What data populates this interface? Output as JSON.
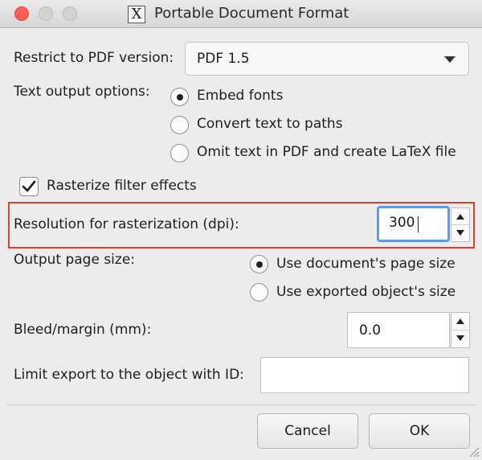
{
  "window": {
    "title": "Portable Document Format",
    "app_icon": "X"
  },
  "pdf_version": {
    "label": "Restrict to PDF version:",
    "value": "PDF 1.5"
  },
  "text_output": {
    "label": "Text output options:",
    "options": [
      "Embed fonts",
      "Convert text to paths",
      "Omit text in PDF and create LaTeX file"
    ],
    "selected": "Embed fonts"
  },
  "rasterize": {
    "label": "Rasterize filter effects",
    "checked": true
  },
  "resolution": {
    "label": "Resolution for rasterization (dpi):",
    "value": "300"
  },
  "page_size": {
    "label": "Output page size:",
    "options": [
      "Use document's page size",
      "Use exported object's size"
    ],
    "selected": "Use document's page size"
  },
  "bleed": {
    "label": "Bleed/margin (mm):",
    "value": "0.0"
  },
  "limit_export": {
    "label": "Limit export to the object with ID:",
    "value": ""
  },
  "buttons": {
    "cancel": "Cancel",
    "ok": "OK"
  },
  "colors": {
    "highlight": "#e1402a",
    "focus_ring": "#5c9be8",
    "close": "#fc5f57"
  }
}
